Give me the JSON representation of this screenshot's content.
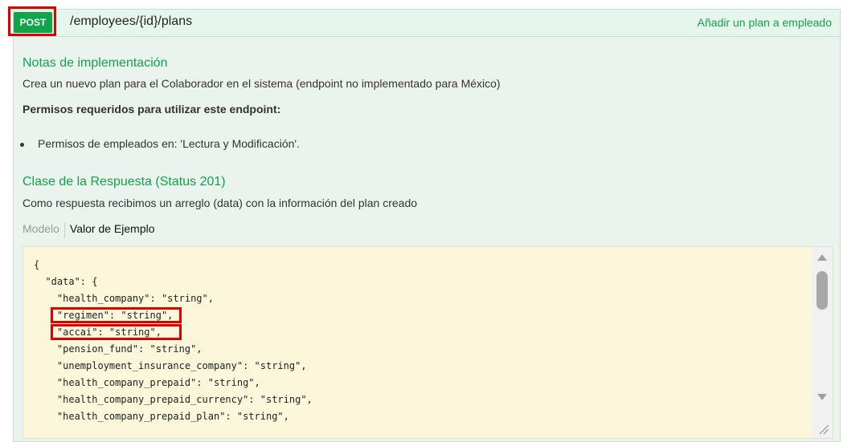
{
  "header": {
    "method": "POST",
    "path": "/employees/{id}/plans",
    "summary": "Añadir un plan a empleado"
  },
  "implementation": {
    "title": "Notas de implementación",
    "description": "Crea un nuevo plan para el Colaborador en el sistema (endpoint no implementado para México)",
    "permissions_title": "Permisos requeridos para utilizar este endpoint:",
    "permissions": [
      "Permisos de empleados en: 'Lectura y Modificación'."
    ]
  },
  "response": {
    "title": "Clase de la Respuesta (Status 201)",
    "description": "Como respuesta recibimos un arreglo (data) con la información del plan creado",
    "tabs": {
      "model": "Modelo",
      "example": "Valor de Ejemplo"
    },
    "code_lines": [
      "{",
      "  \"data\": {",
      "    \"health_company\": \"string\",",
      "    \"regimen\": \"string\",",
      "    \"accai\": \"string\",",
      "    \"pension_fund\": \"string\",",
      "    \"unemployment_insurance_company\": \"string\",",
      "    \"health_company_prepaid\": \"string\",",
      "    \"health_company_prepaid_currency\": \"string\",",
      "    \"health_company_prepaid_plan\": \"string\","
    ]
  },
  "colors": {
    "accent_green": "#10a54a",
    "highlight_red": "#e00000",
    "code_bg": "#fcf6db"
  }
}
